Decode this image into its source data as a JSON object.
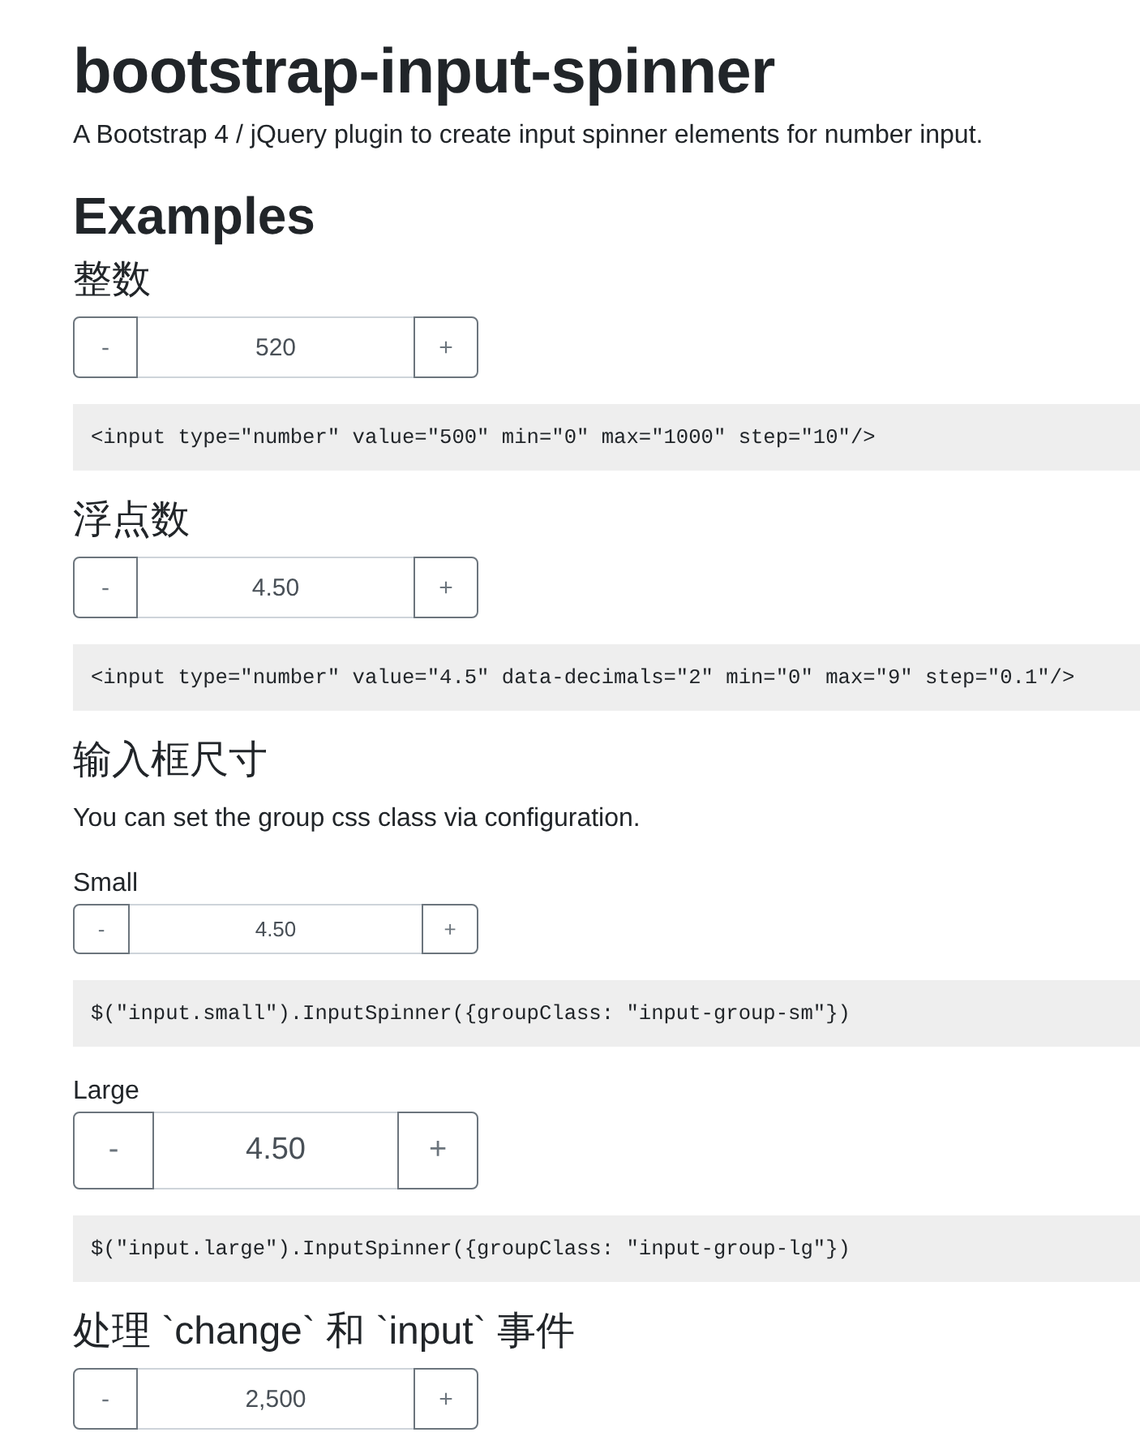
{
  "title": "bootstrap-input-spinner",
  "lead": "A Bootstrap 4 / jQuery plugin to create input spinner elements for number input.",
  "examples_heading": "Examples",
  "sections": [
    {
      "heading": "整数",
      "items": [
        {
          "kind": "spinner",
          "small": false,
          "large": false,
          "decrement": "-",
          "value": "520",
          "increment": "+"
        },
        {
          "kind": "code",
          "code": "<input type=\"number\" value=\"500\" min=\"0\" max=\"1000\" step=\"10\"/>"
        }
      ]
    },
    {
      "heading": "浮点数",
      "items": [
        {
          "kind": "spinner",
          "small": false,
          "large": false,
          "decrement": "-",
          "value": "4.50",
          "increment": "+"
        },
        {
          "kind": "code",
          "code": "<input type=\"number\" value=\"4.5\" data-decimals=\"2\" min=\"0\" max=\"9\" step=\"0.1\"/>"
        }
      ]
    },
    {
      "heading": "输入框尺寸",
      "items": [
        {
          "kind": "text",
          "text": "You can set the group css class via configuration."
        },
        {
          "kind": "label",
          "text": "Small"
        },
        {
          "kind": "spinner",
          "small": true,
          "large": false,
          "decrement": "-",
          "value": "4.50",
          "increment": "+"
        },
        {
          "kind": "code",
          "code": "$(\"input.small\").InputSpinner({groupClass: \"input-group-sm\"})"
        },
        {
          "kind": "label",
          "text": "Large"
        },
        {
          "kind": "spinner",
          "small": false,
          "large": true,
          "decrement": "-",
          "value": "4.50",
          "increment": "+"
        },
        {
          "kind": "code",
          "code": "$(\"input.large\").InputSpinner({groupClass: \"input-group-lg\"})"
        }
      ]
    },
    {
      "heading": "处理 `change` 和 `input` 事件",
      "items": [
        {
          "kind": "spinner",
          "small": false,
          "large": false,
          "decrement": "-",
          "value": "2,500",
          "increment": "+"
        }
      ]
    }
  ]
}
